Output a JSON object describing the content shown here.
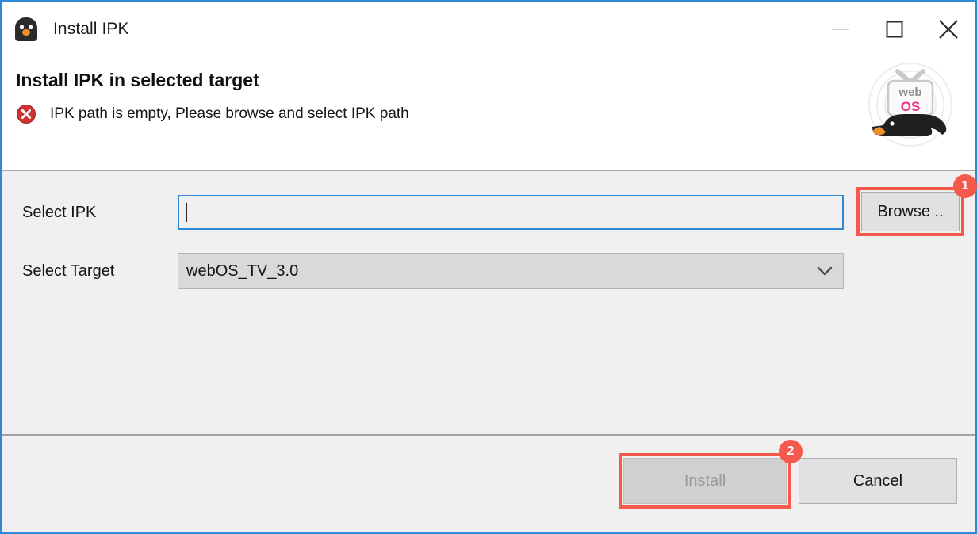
{
  "window": {
    "title": "Install IPK",
    "app_icon": "webos-penguin-icon",
    "accent_border": "#2e8ad6",
    "controls": {
      "minimize": "minimize-icon",
      "maximize": "maximize-icon",
      "close": "close-icon"
    }
  },
  "header": {
    "title": "Install IPK in selected target",
    "message": "IPK path is empty, Please browse and select IPK path",
    "message_icon": "error-icon",
    "message_icon_color": "#cc3333",
    "brand_logo": "webos-tv-logo",
    "brand_text_top": "web",
    "brand_text_bottom": "OS",
    "brand_color": "#e8368f"
  },
  "form": {
    "ipk": {
      "label": "Select IPK",
      "value": "",
      "placeholder": "",
      "focused": true,
      "browse_label": "Browse .."
    },
    "target": {
      "label": "Select Target",
      "value": "webOS_TV_3.0",
      "options": [
        "webOS_TV_3.0"
      ],
      "chevron": "chevron-down-icon"
    }
  },
  "footer": {
    "install_label": "Install",
    "install_disabled": true,
    "cancel_label": "Cancel"
  },
  "annotations": {
    "badge_color": "#f4594c",
    "items": [
      {
        "number": "1",
        "target": "browse-button"
      },
      {
        "number": "2",
        "target": "install-button"
      }
    ]
  }
}
